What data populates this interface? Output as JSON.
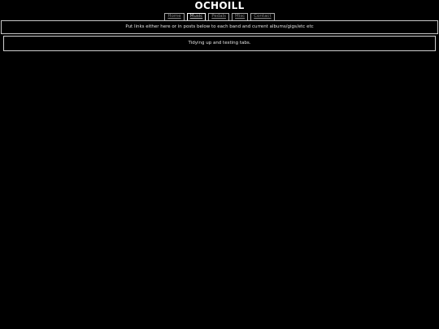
{
  "site": {
    "title": "OCHOILL"
  },
  "nav": {
    "tabs": [
      {
        "label": "Home",
        "active": false
      },
      {
        "label": "Music",
        "active": true
      },
      {
        "label": "Pedals",
        "active": false
      },
      {
        "label": "Misc",
        "active": false
      },
      {
        "label": "Contact",
        "active": false
      }
    ]
  },
  "main": {
    "info_text": "Put links either here or in posts below to each band and current albums/gigs/etc etc",
    "post_text": "Tidying up and testing tabs."
  },
  "colors": {
    "background": "#000000",
    "text": "#ffffff",
    "border": "#c8c8c8",
    "tab_text": "#8a8a8a"
  }
}
